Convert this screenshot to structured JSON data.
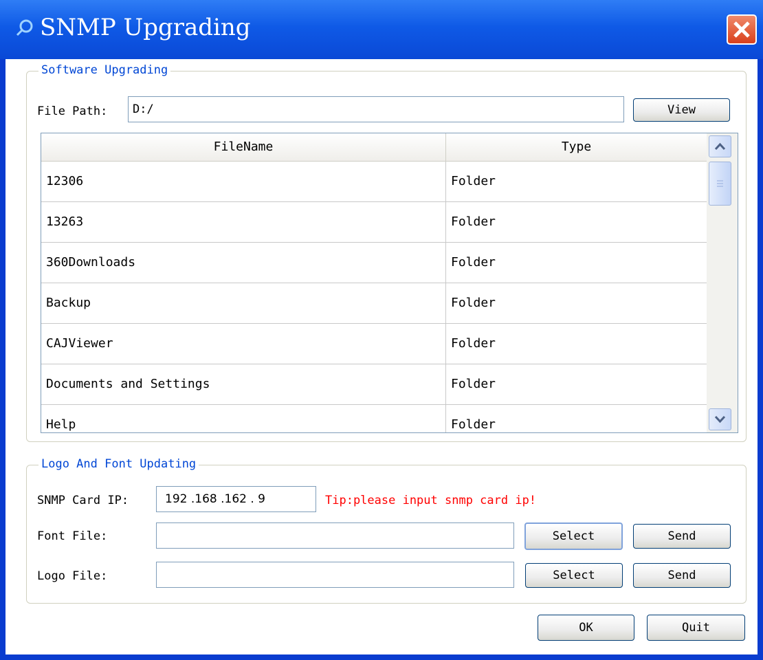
{
  "window": {
    "title": "SNMP Upgrading"
  },
  "software_group": {
    "title": "Software Upgrading",
    "file_path_label": "File Path:",
    "file_path_value": "D:/",
    "view_button": "View",
    "table": {
      "headers": [
        "FileName",
        "Type"
      ],
      "rows": [
        {
          "name": "12306",
          "type": "Folder"
        },
        {
          "name": "13263",
          "type": "Folder"
        },
        {
          "name": "360Downloads",
          "type": "Folder"
        },
        {
          "name": "Backup",
          "type": "Folder"
        },
        {
          "name": "CAJViewer",
          "type": "Folder"
        },
        {
          "name": "Documents and Settings",
          "type": "Folder"
        },
        {
          "name": "Help",
          "type": "Folder"
        }
      ]
    }
  },
  "logo_group": {
    "title": "Logo And Font Updating",
    "ip_label": "SNMP Card IP:",
    "ip_value": "192 .168 .162 . 9",
    "tip": "Tip:please input snmp card ip!",
    "font_label": "Font File:",
    "font_value": "",
    "logo_label": "Logo File:",
    "logo_value": "",
    "select_button": "Select",
    "send_button": "Send"
  },
  "footer": {
    "ok_button": "OK",
    "quit_button": "Quit"
  },
  "colors": {
    "titlebar": "#0a48d6",
    "group_title": "#0046d5",
    "tip": "#ff0000",
    "close_button": "#d9401c"
  },
  "icons": [
    "search-icon",
    "close-icon",
    "scroll-up-icon",
    "scroll-down-icon"
  ]
}
